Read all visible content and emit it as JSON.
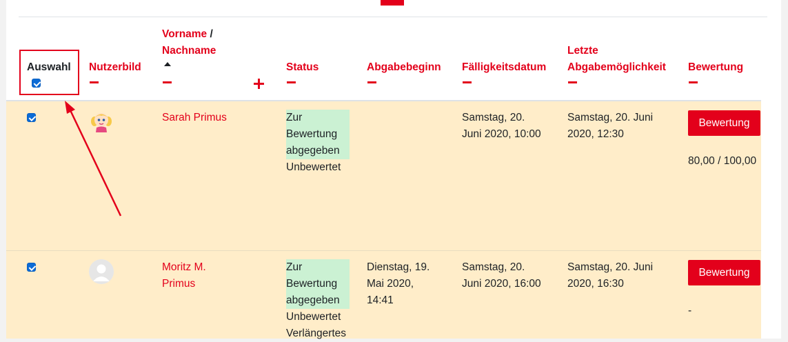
{
  "header": {
    "auswahl": "Auswahl",
    "nutzerbild": "Nutzerbild",
    "vorname": "Vorname",
    "slash": " /",
    "nachname": "Nachname",
    "status": "Status",
    "abgabebeginn": "Abgabebeginn",
    "faelligkeitsdatum": "Fälligkeitsdatum",
    "letzte_line1": "Letzte",
    "letzte_line2": "Abgabemöglichkeit",
    "bewertung": "Bewertung"
  },
  "rows": [
    {
      "selected": true,
      "avatar_icon": "girl-cartoon-avatar",
      "name": "Sarah Primus",
      "status_line1": "Zur",
      "status_line2": "Bewertung",
      "status_line3": "abgegeben",
      "status_line4": "Unbewertet",
      "abgabebeginn_1": "",
      "faellig_1": "Samstag, 20.",
      "faellig_2": "Juni 2020, 10:00",
      "letzte_1": "Samstag, 20. Juni",
      "letzte_2": "2020, 12:30",
      "grade_button": "Bewertung",
      "grade_value": "80,00 / 100,00"
    },
    {
      "selected": true,
      "avatar_icon": "default-user-avatar",
      "name_1": "Moritz M.",
      "name_2": "Primus",
      "status_line1": "Zur",
      "status_line2": "Bewertung",
      "status_line3": "abgegeben",
      "status_line4": "Unbewertet",
      "status_line5": "Verlängertes",
      "abgabebeginn_1": "Dienstag, 19.",
      "abgabebeginn_2": "Mai 2020,",
      "abgabebeginn_3": "14:41",
      "faellig_1": "Samstag, 20.",
      "faellig_2": "Juni 2020, 16:00",
      "letzte_1": "Samstag, 20. Juni",
      "letzte_2": "2020, 16:30",
      "grade_button": "Bewertung",
      "grade_value": "-"
    }
  ],
  "colors": {
    "accent": "#e3001b",
    "row_bg": "#ffedc9",
    "status_bg": "#cbf1d3",
    "checkbox": "#0b6bd6"
  }
}
